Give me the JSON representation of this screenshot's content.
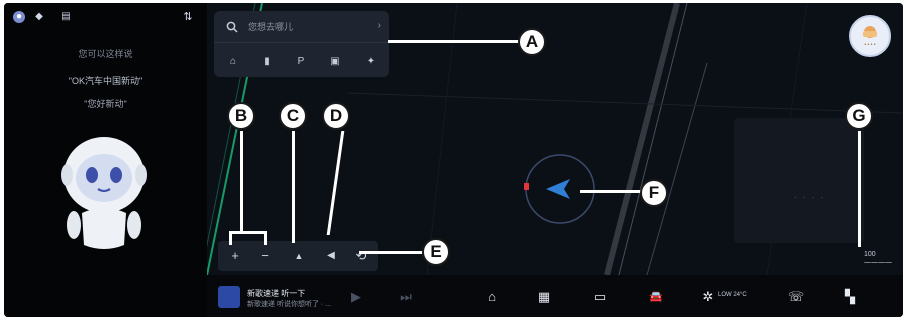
{
  "status_bar": {
    "icons": [
      "user-avatar-icon",
      "shield-icon",
      "signal-icon",
      "menu-icon"
    ],
    "labels": [
      "●",
      "◆",
      "▤",
      "⇅"
    ]
  },
  "assistant": {
    "hint": "您可以这样说",
    "example_1": "\"OK汽车中国新动\"",
    "example_2": "\"您好新动\""
  },
  "search": {
    "placeholder": "您想去哪儿",
    "arrow": "›",
    "quick_icons": [
      "home-icon",
      "company-icon",
      "parking-icon",
      "charging-icon",
      "more-icon"
    ],
    "quick_labels": [
      "⌂",
      "▮",
      "P",
      "▣",
      "✦"
    ]
  },
  "map_controls": {
    "zoom_in": "+",
    "zoom_out": "−",
    "north_up": "▲",
    "volume": "◀",
    "refresh": "⟲"
  },
  "map": {
    "poi_dots": "· · · ·",
    "scale_top": "100",
    "scale_bottom": "一一一一"
  },
  "avatar": {
    "label": "• • • •"
  },
  "media": {
    "title": "新歌速递 听一下",
    "subtitle": "新歌速递 听说你想听了 · ..."
  },
  "dock": {
    "icons": [
      "play-icon",
      "next-icon",
      "home-icon",
      "apps-icon",
      "seat-heating-icon",
      "car-icon",
      "fan-icon",
      "phone-icon",
      "settings-icon"
    ],
    "labels": [
      "▶",
      "⏭",
      "⌂",
      "▦",
      "▭",
      "🚘",
      "✲",
      "☏",
      "▚"
    ],
    "fan_temp": "LOW 24°C"
  },
  "callouts": {
    "A": "A",
    "B": "B",
    "C": "C",
    "D": "D",
    "E": "E",
    "F": "F",
    "G": "G"
  },
  "colors": {
    "map_bg": "#0b0f16",
    "navigation_arrow": "#2f7fd6",
    "location_marker": "#e0353a",
    "accent_green": "#1bbf7a"
  }
}
